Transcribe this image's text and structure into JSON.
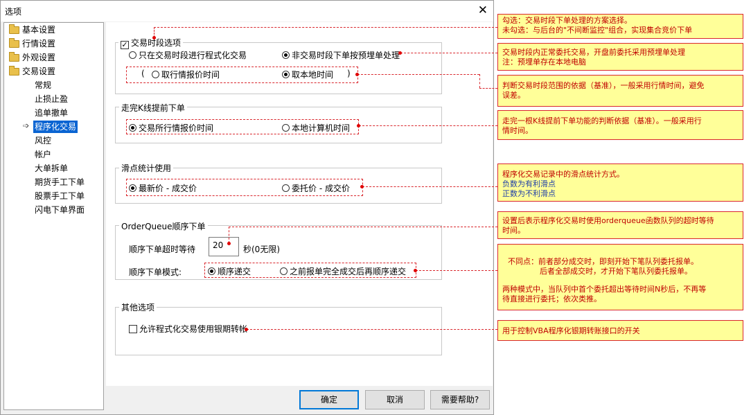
{
  "dialog": {
    "title": "选项",
    "close_glyph": "✕"
  },
  "tree": {
    "items": [
      {
        "label": "基本设置"
      },
      {
        "label": "行情设置"
      },
      {
        "label": "外观设置"
      },
      {
        "label": "交易设置"
      },
      {
        "label": "常规"
      },
      {
        "label": "止损止盈"
      },
      {
        "label": "追单撤单"
      },
      {
        "label": "程序化交易"
      },
      {
        "label": "风控"
      },
      {
        "label": "帐户"
      },
      {
        "label": "大单拆单"
      },
      {
        "label": "期货手工下单"
      },
      {
        "label": "股票手工下单"
      },
      {
        "label": "闪电下单界面"
      }
    ],
    "selected": "程序化交易"
  },
  "groups": {
    "trading_period": {
      "label": "交易时段选项",
      "checked": true,
      "opt_only": "只在交易时段进行程式化交易",
      "opt_nontrading": "非交易时段下单按预埋单处理",
      "paren_open": "(",
      "opt_quote_time": "取行情报价时间",
      "opt_local_time": "取本地时间",
      "paren_close": ")"
    },
    "kline": {
      "label": "走完K线提前下单",
      "opt_exchange": "交易所行情报价时间",
      "opt_local": "本地计算机时间"
    },
    "slippage": {
      "label": "滑点统计使用",
      "opt_latest": "最新价 - 成交价",
      "opt_order": "委托价 - 成交价"
    },
    "orderqueue": {
      "label": "OrderQueue顺序下单",
      "timeout_label": "顺序下单超时等待",
      "timeout_value": "20",
      "timeout_unit": "秒(0无限)",
      "mode_label": "顺序下单模式:",
      "opt_sequential": "顺序递交",
      "opt_after_done": "之前报单完全成交后再顺序递交"
    },
    "other": {
      "label": "其他选项",
      "opt_vba": "允许程式化交易使用银期转帐"
    }
  },
  "buttons": {
    "ok": "确定",
    "cancel": "取消",
    "help": "需要帮助?"
  },
  "notes": {
    "n1": {
      "line1": "勾选：交易时段下单处理的方案选择。",
      "line2": "未勾选：与后台的\"不间断监控\"组合，实现集合竞价下单"
    },
    "n2": {
      "line1": "交易时段内正常委托交易，开盘前委托采用预埋单处理",
      "line2": "注：预埋单存在本地电脑"
    },
    "n3": {
      "line1": "判断交易时段范围的依据（基准），一般采用行情时间，避免",
      "line2": "误差。"
    },
    "n4": {
      "line1": "走完一根K线提前下单功能的判断依据（基准）。一般采用行",
      "line2": "情时间。"
    },
    "n5": {
      "line1": "程序化交易记录中的滑点统计方式。",
      "line2": "负数为有利滑点",
      "line3": "正数为不利滑点"
    },
    "n6": {
      "line1": "设置后表示程序化交易时使用orderqueue函数队列的超时等待",
      "line2": "时间。"
    },
    "n7": {
      "line1": "不同点：前者部分成交时，即刻开始下笔队列委托报单。",
      "line2": "后者全部成交时，才开始下笔队列委托报单。",
      "line3": "两种模式中，当队列中首个委托超出等待时间N秒后，不再等",
      "line4": "待直接进行委托；依次类推。"
    },
    "n8": {
      "line1": "用于控制VBA程序化银期转账接口的开关"
    }
  },
  "colors": {
    "selection": "#0a64d2",
    "note_bg": "#ffff99",
    "note_text": "#c00000",
    "annotation": "#d9262c"
  }
}
